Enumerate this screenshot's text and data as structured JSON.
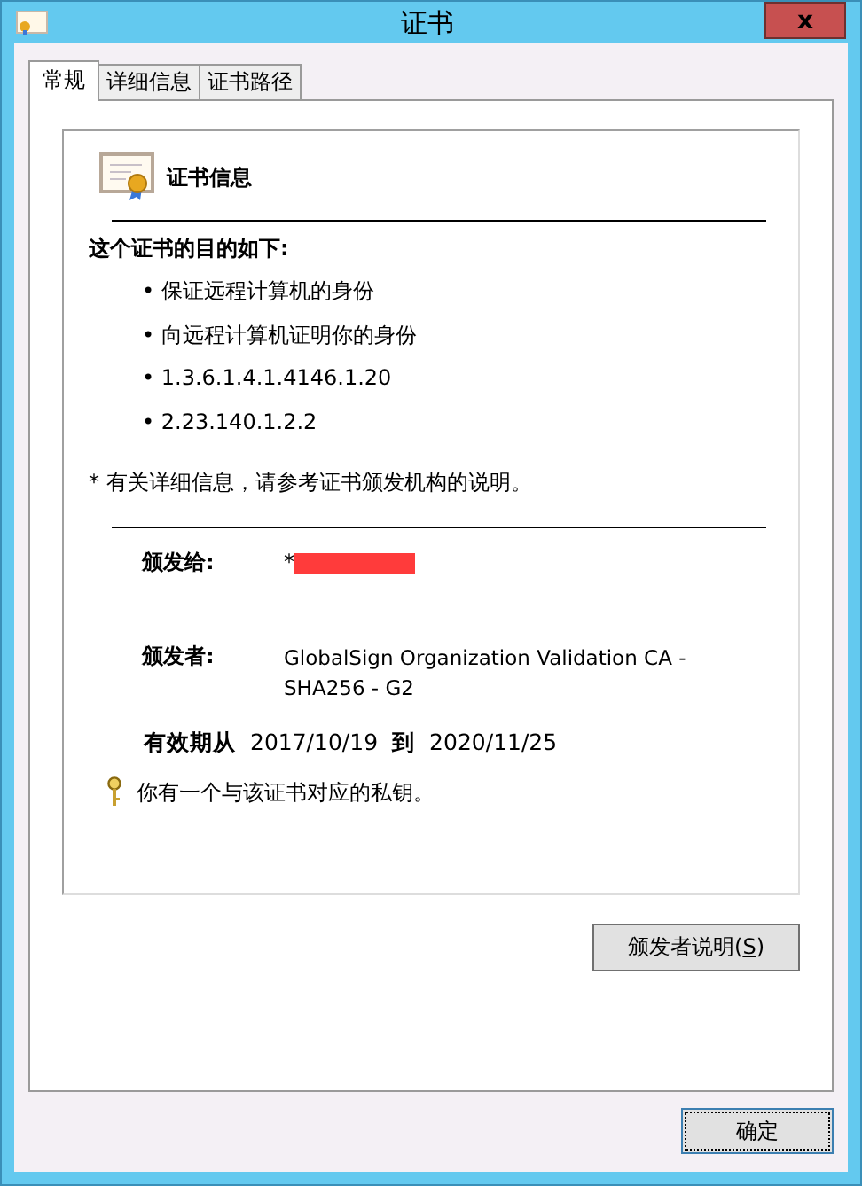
{
  "window": {
    "title": "证书",
    "close": "x"
  },
  "tabs": [
    {
      "label": "常规",
      "selected": true
    },
    {
      "label": "详细信息",
      "selected": false
    },
    {
      "label": "证书路径",
      "selected": false
    }
  ],
  "info": {
    "heading": "证书信息",
    "purpose_title": "这个证书的目的如下:",
    "purposes": [
      "• 保证远程计算机的身份",
      "• 向远程计算机证明你的身份",
      "• 1.3.6.1.4.1.4146.1.20",
      "• 2.23.140.1.2.2"
    ],
    "note": "* 有关详细信息，请参考证书颁发机构的说明。",
    "issued_to": {
      "label": "颁发给:",
      "value": "*",
      "redacted": true
    },
    "issued_by": {
      "label": "颁发者:",
      "value": "GlobalSign Organization Validation CA - SHA256 - G2"
    },
    "validity": {
      "label": "有效期从",
      "from": "2017/10/19",
      "to_label": "到",
      "to": "2020/11/25"
    },
    "private_key": "你有一个与该证书对应的私钥。"
  },
  "issuer_button": {
    "label": "颁发者说明(",
    "access_key": "S",
    "label_end": ")"
  },
  "ok_button": {
    "label": "确定",
    "focused": true
  }
}
